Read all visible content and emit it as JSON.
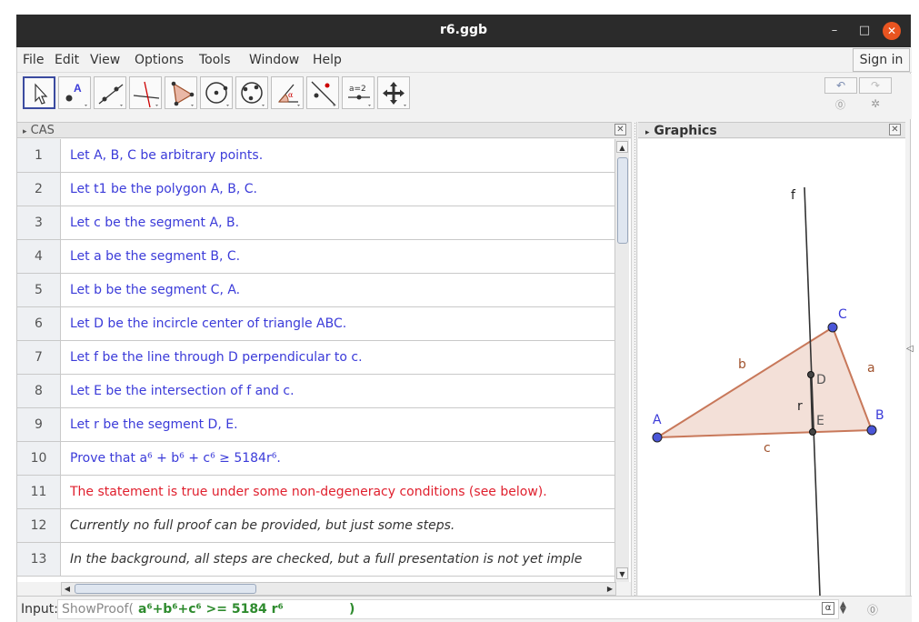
{
  "window": {
    "title": "r6.ggb"
  },
  "menu": {
    "items": [
      "File",
      "Edit",
      "View",
      "Options",
      "Tools",
      "Window",
      "Help"
    ],
    "sign_in": "Sign in"
  },
  "toolbar": {
    "tools": [
      "move-tool",
      "point-tool",
      "line-tool",
      "perpendicular-line-tool",
      "polygon-tool",
      "circle-tool",
      "circle-three-points-tool",
      "angle-tool",
      "reflect-tool",
      "slider-tool",
      "move-graphics-view-tool"
    ],
    "slider_label": "a=2",
    "undo_icon": "undo-icon",
    "redo_icon": "redo-icon",
    "help_icon": "help-icon",
    "settings_icon": "settings-icon"
  },
  "cas": {
    "header": "CAS",
    "rows": [
      {
        "num": "1",
        "text": "Let A, B, C be arbitrary points.",
        "style": "blue"
      },
      {
        "num": "2",
        "text": "Let t1 be the polygon A, B, C.",
        "style": "blue"
      },
      {
        "num": "3",
        "text": "Let c be the segment A, B.",
        "style": "blue"
      },
      {
        "num": "4",
        "text": "Let a be the segment B, C.",
        "style": "blue"
      },
      {
        "num": "5",
        "text": "Let b be the segment C, A.",
        "style": "blue"
      },
      {
        "num": "6",
        "text": "Let D be the incircle center of triangle ABC.",
        "style": "blue"
      },
      {
        "num": "7",
        "text": "Let f be the line through D perpendicular to c.",
        "style": "blue"
      },
      {
        "num": "8",
        "text": "Let E be the intersection of f and c.",
        "style": "blue"
      },
      {
        "num": "9",
        "text": "Let r be the segment D, E.",
        "style": "blue"
      },
      {
        "num": "10",
        "text": "Prove that a⁶ + b⁶ + c⁶ ≥ 5184r⁶.",
        "style": "blue"
      },
      {
        "num": "11",
        "text": "The statement is true under some non-degeneracy conditions (see below).",
        "style": "red"
      },
      {
        "num": "12",
        "text": "Currently no full proof can be provided, but just some steps.",
        "style": "italic"
      },
      {
        "num": "13",
        "text": "In the background, all steps are checked, but a full presentation is not yet imple",
        "style": "italic"
      }
    ]
  },
  "graphics": {
    "header": "Graphics",
    "labels": {
      "f": "f",
      "A": "A",
      "B": "B",
      "C": "C",
      "D": "D",
      "E": "E",
      "a": "a",
      "b": "b",
      "c": "c",
      "r": "r"
    },
    "colors": {
      "triangle_fill": "#f3e0d8",
      "triangle_edge": "#c8785a",
      "point_fill": "#4a56d8",
      "label_blue": "#3b3bd9",
      "label_brown": "#a0522d"
    }
  },
  "input": {
    "label": "Input:",
    "command": "ShowProof(",
    "expression": " a⁶+b⁶+c⁶ >= 5184 r⁶ ",
    "close": ")"
  }
}
